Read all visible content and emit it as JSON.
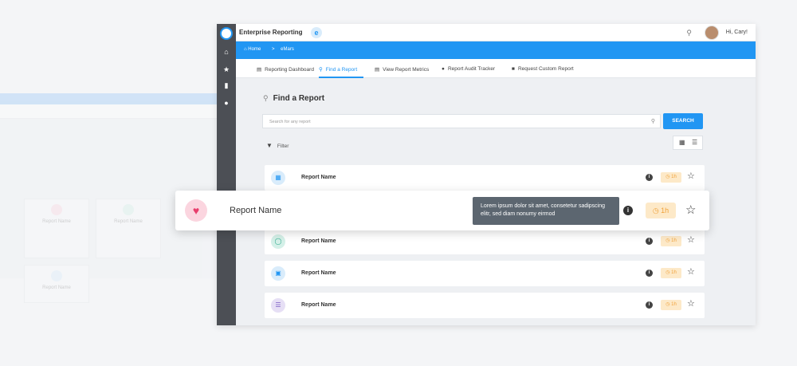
{
  "app": {
    "title": "Enterprise Reporting",
    "logo_letter": "e",
    "greeting": "Hi, Cary!"
  },
  "breadcrumb": {
    "home": "Home",
    "separator": ">",
    "current": "eMars"
  },
  "tabs": [
    {
      "label": "Reporting Dashboard",
      "icon": "chart-icon",
      "active": false
    },
    {
      "label": "Find a Report",
      "icon": "search-icon",
      "active": true
    },
    {
      "label": "View Report Metrics",
      "icon": "line-chart-icon",
      "active": false
    },
    {
      "label": "Report Audit Tracker",
      "icon": "pin-icon",
      "active": false
    },
    {
      "label": "Request Custom Report",
      "icon": "clipboard-icon",
      "active": false
    }
  ],
  "page": {
    "heading": "Find a Report",
    "search_placeholder": "Search for any report",
    "search_button": "SEARCH",
    "filter_label": "Filter"
  },
  "reports": [
    {
      "name": "Report Name",
      "icon": "document-icon",
      "color": "#2196f3",
      "bg": "#d9ecfb",
      "time": "1h"
    },
    {
      "name": "Report Name",
      "icon": "stethoscope-icon",
      "color": "#2aa889",
      "bg": "#d4f0e8",
      "time": "1h"
    },
    {
      "name": "Report Name",
      "icon": "hospital-icon",
      "color": "#2196f3",
      "bg": "#d9ecfb",
      "time": "1h"
    },
    {
      "name": "Report Name",
      "icon": "database-icon",
      "color": "#7b5cc4",
      "bg": "#e6dff5",
      "time": "1h"
    }
  ],
  "highlight": {
    "name": "Report Name",
    "icon": "heart-pulse-icon",
    "tooltip": "Lorem ipsum dolor sit amet, consetetur sadipscing elitr, sed diam nonumy eirmod",
    "time": "1h"
  },
  "background_cards": [
    {
      "label": "Report Name"
    },
    {
      "label": "Report Name"
    },
    {
      "label": "Report Name"
    }
  ],
  "colors": {
    "accent": "#2196f3",
    "sidebar": "#4c4f55",
    "badge": "#fde9c8"
  }
}
